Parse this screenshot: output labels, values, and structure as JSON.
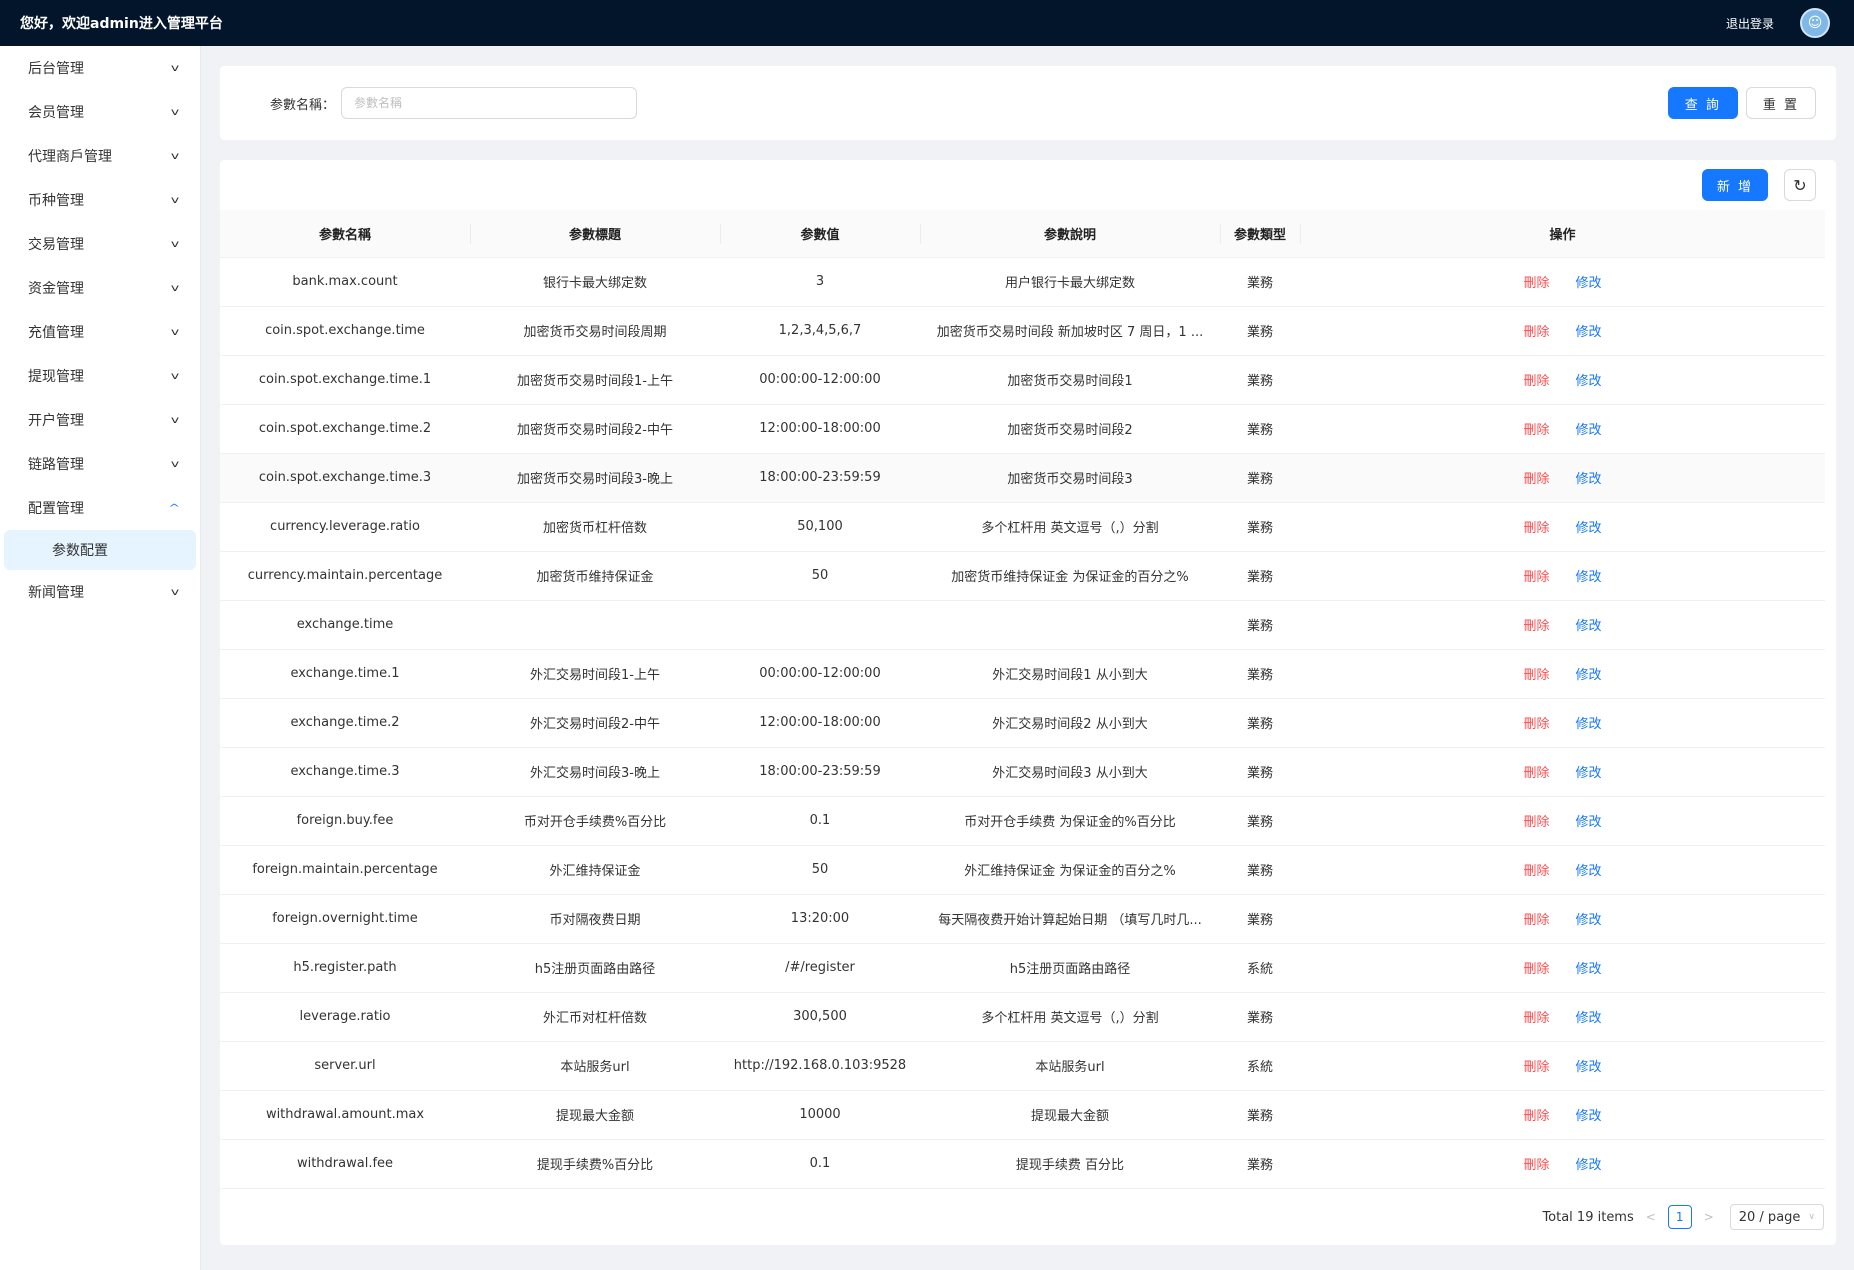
{
  "header": {
    "welcome": "您好，欢迎admin进入管理平台",
    "logout": "退出登录"
  },
  "sidebar": {
    "items": [
      {
        "label": "后台管理",
        "open": false
      },
      {
        "label": "会员管理",
        "open": false
      },
      {
        "label": "代理商戶管理",
        "open": false
      },
      {
        "label": "币种管理",
        "open": false
      },
      {
        "label": "交易管理",
        "open": false
      },
      {
        "label": "资金管理",
        "open": false
      },
      {
        "label": "充值管理",
        "open": false
      },
      {
        "label": "提现管理",
        "open": false
      },
      {
        "label": "开户管理",
        "open": false
      },
      {
        "label": "链路管理",
        "open": false
      },
      {
        "label": "配置管理",
        "open": true,
        "children": [
          "参数配置"
        ]
      },
      {
        "label": "新闻管理",
        "open": false
      }
    ],
    "active_child": "参数配置"
  },
  "search": {
    "label": "参數名稱：",
    "placeholder": "参數名稱",
    "query_button": "查 詢",
    "reset_button": "重 置"
  },
  "toolbar": {
    "add_button": "新 增"
  },
  "table": {
    "columns": [
      "参數名稱",
      "参數標題",
      "参數值",
      "参數說明",
      "参數類型",
      "操作"
    ],
    "delete_label": "刪除",
    "edit_label": "修改",
    "rows": [
      [
        "bank.max.count",
        "银行卡最大绑定数",
        "3",
        "用户银行卡最大绑定数",
        "業務"
      ],
      [
        "coin.spot.exchange.time",
        "加密货币交易时间段周期",
        "1,2,3,4,5,6,7",
        "加密货币交易时间段 新加坡时区 7 周日，1 ...",
        "業務"
      ],
      [
        "coin.spot.exchange.time.1",
        "加密货币交易时间段1-上午",
        "00:00:00-12:00:00",
        "加密货币交易时间段1",
        "業務"
      ],
      [
        "coin.spot.exchange.time.2",
        "加密货币交易时间段2-中午",
        "12:00:00-18:00:00",
        "加密货币交易时间段2",
        "業務"
      ],
      [
        "coin.spot.exchange.time.3",
        "加密货币交易时间段3-晚上",
        "18:00:00-23:59:59",
        "加密货币交易时间段3",
        "業務"
      ],
      [
        "currency.leverage.ratio",
        "加密货币杠杆倍数",
        "50,100",
        "多个杠杆用 英文逗号（,）分割",
        "業務"
      ],
      [
        "currency.maintain.percentage",
        "加密货币维持保证金",
        "50",
        "加密货币维持保证金 为保证金的百分之%",
        "業務"
      ],
      [
        "exchange.time",
        "",
        "",
        "",
        "業務"
      ],
      [
        "exchange.time.1",
        "外汇交易时间段1-上午",
        "00:00:00-12:00:00",
        "外汇交易时间段1 从小到大",
        "業務"
      ],
      [
        "exchange.time.2",
        "外汇交易时间段2-中午",
        "12:00:00-18:00:00",
        "外汇交易时间段2 从小到大",
        "業務"
      ],
      [
        "exchange.time.3",
        "外汇交易时间段3-晚上",
        "18:00:00-23:59:59",
        "外汇交易时间段3 从小到大",
        "業務"
      ],
      [
        "foreign.buy.fee",
        "币对开仓手续费%百分比",
        "0.1",
        "币对开仓手续费 为保证金的%百分比",
        "業務"
      ],
      [
        "foreign.maintain.percentage",
        "外汇维持保证金",
        "50",
        "外汇维持保证金 为保证金的百分之%",
        "業務"
      ],
      [
        "foreign.overnight.time",
        "币对隔夜费日期",
        "13:20:00",
        "每天隔夜费开始计算起始日期 （填写几时几...",
        "業務"
      ],
      [
        "h5.register.path",
        "h5注册页面路由路径",
        "/#/register",
        "h5注册页面路由路径",
        "系統"
      ],
      [
        "leverage.ratio",
        "外汇币对杠杆倍数",
        "300,500",
        "多个杠杆用 英文逗号（,）分割",
        "業務"
      ],
      [
        "server.url",
        "本站服务url",
        "http://192.168.0.103:9528",
        "本站服务url",
        "系統"
      ],
      [
        "withdrawal.amount.max",
        "提现最大金额",
        "10000",
        "提现最大金额",
        "業務"
      ],
      [
        "withdrawal.fee",
        "提现手续费%百分比",
        "0.1",
        "提现手续费 百分比",
        "業務"
      ]
    ],
    "hover_row_index": 4
  },
  "pagination": {
    "total": "Total 19 items",
    "current_page": "1",
    "page_size": "20 / page"
  },
  "colors": {
    "topbar": "#03152a",
    "primary": "#1677ff",
    "danger": "#ff4d4f",
    "active_menu_bg": "#e6f4ff"
  },
  "icons": {
    "menu_chevron": "chevron-down-icon",
    "refresh": "refresh-icon",
    "avatar": "avatar-icon"
  }
}
